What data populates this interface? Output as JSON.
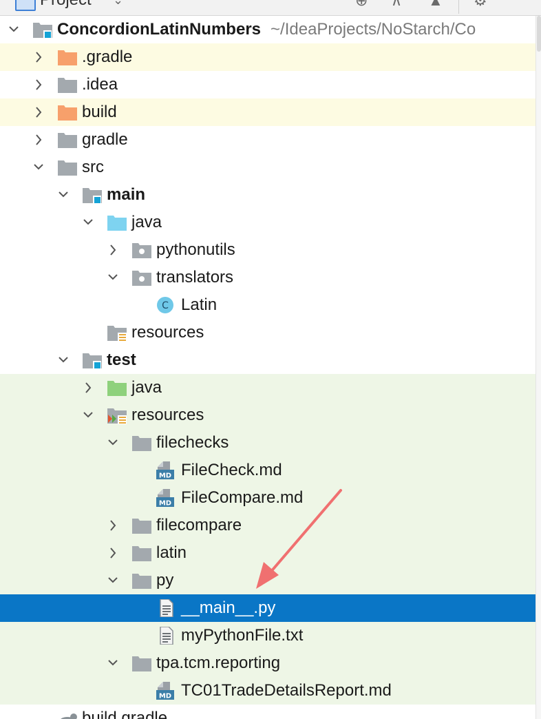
{
  "panel": {
    "title": "Project",
    "icons": [
      "project-panel-icon",
      "chevron-down-icon",
      "globe-icon",
      "collapse-all-icon",
      "expand-icon",
      "gear-icon"
    ]
  },
  "tree": {
    "rows": [
      {
        "label": "ConcordionLatinNumbers",
        "suffix": "~/IdeaProjects/NoStarch/Co",
        "icon": "module-folder-icon",
        "expanded": true,
        "depth": 0,
        "bold": true,
        "bg": "none"
      },
      {
        "label": ".gradle",
        "icon": "excluded-folder-icon",
        "expanded": false,
        "depth": 1,
        "bg": "yellow"
      },
      {
        "label": ".idea",
        "icon": "folder-icon",
        "expanded": false,
        "depth": 1,
        "bg": "none"
      },
      {
        "label": "build",
        "icon": "excluded-folder-icon",
        "expanded": false,
        "depth": 1,
        "bg": "yellow"
      },
      {
        "label": "gradle",
        "icon": "folder-icon",
        "expanded": false,
        "depth": 1,
        "bg": "none"
      },
      {
        "label": "src",
        "icon": "folder-icon",
        "expanded": true,
        "depth": 1,
        "bg": "none"
      },
      {
        "label": "main",
        "icon": "module-folder-icon",
        "expanded": true,
        "depth": 2,
        "bold": true,
        "bg": "none"
      },
      {
        "label": "java",
        "icon": "source-folder-icon",
        "expanded": true,
        "depth": 3,
        "bg": "none"
      },
      {
        "label": "pythonutils",
        "icon": "package-icon",
        "expanded": false,
        "depth": 4,
        "bg": "none"
      },
      {
        "label": "translators",
        "icon": "package-icon",
        "expanded": true,
        "depth": 4,
        "bg": "none"
      },
      {
        "label": "Latin",
        "icon": "java-class-icon",
        "depth": 5,
        "bg": "none"
      },
      {
        "label": "resources",
        "icon": "resources-folder-icon",
        "depth": 3,
        "bg": "none"
      },
      {
        "label": "test",
        "icon": "module-folder-icon",
        "expanded": true,
        "depth": 2,
        "bold": true,
        "bg": "none"
      },
      {
        "label": "java",
        "icon": "test-source-folder-icon",
        "expanded": false,
        "depth": 3,
        "bg": "green"
      },
      {
        "label": "resources",
        "icon": "test-resources-folder-icon",
        "expanded": true,
        "depth": 3,
        "bg": "green"
      },
      {
        "label": "filechecks",
        "icon": "folder-icon",
        "expanded": true,
        "depth": 4,
        "bg": "green"
      },
      {
        "label": "FileCheck.md",
        "icon": "markdown-file-icon",
        "depth": 5,
        "bg": "green"
      },
      {
        "label": "FileCompare.md",
        "icon": "markdown-file-icon",
        "depth": 5,
        "bg": "green"
      },
      {
        "label": "filecompare",
        "icon": "folder-icon",
        "expanded": false,
        "depth": 4,
        "bg": "green"
      },
      {
        "label": "latin",
        "icon": "folder-icon",
        "expanded": false,
        "depth": 4,
        "bg": "green"
      },
      {
        "label": "py",
        "icon": "folder-icon",
        "expanded": true,
        "depth": 4,
        "bg": "green"
      },
      {
        "label": "__main__.py",
        "icon": "text-file-icon",
        "depth": 5,
        "bg": "selected"
      },
      {
        "label": "myPythonFile.txt",
        "icon": "text-file-icon",
        "depth": 5,
        "bg": "green"
      },
      {
        "label": "tpa.tcm.reporting",
        "icon": "folder-icon",
        "expanded": true,
        "depth": 4,
        "bg": "green"
      },
      {
        "label": "TC01TradeDetailsReport.md",
        "icon": "markdown-file-icon",
        "depth": 5,
        "bg": "green"
      },
      {
        "label": "build.gradle",
        "icon": "gradle-file-icon",
        "depth": 1,
        "bg": "none"
      }
    ]
  },
  "annotation": {
    "type": "arrow",
    "color": "#f07070",
    "points_to": "__main__.py"
  },
  "colors": {
    "selection": "#0a76c6",
    "excluded_highlight": "#fdfbe2",
    "test_highlight": "#eef6e6",
    "folder_grey": "#a3a9ae",
    "excluded_orange": "#f7a06b",
    "source_blue": "#7ed3f0",
    "test_green": "#8ed17c",
    "annotation_red": "#f07070"
  }
}
